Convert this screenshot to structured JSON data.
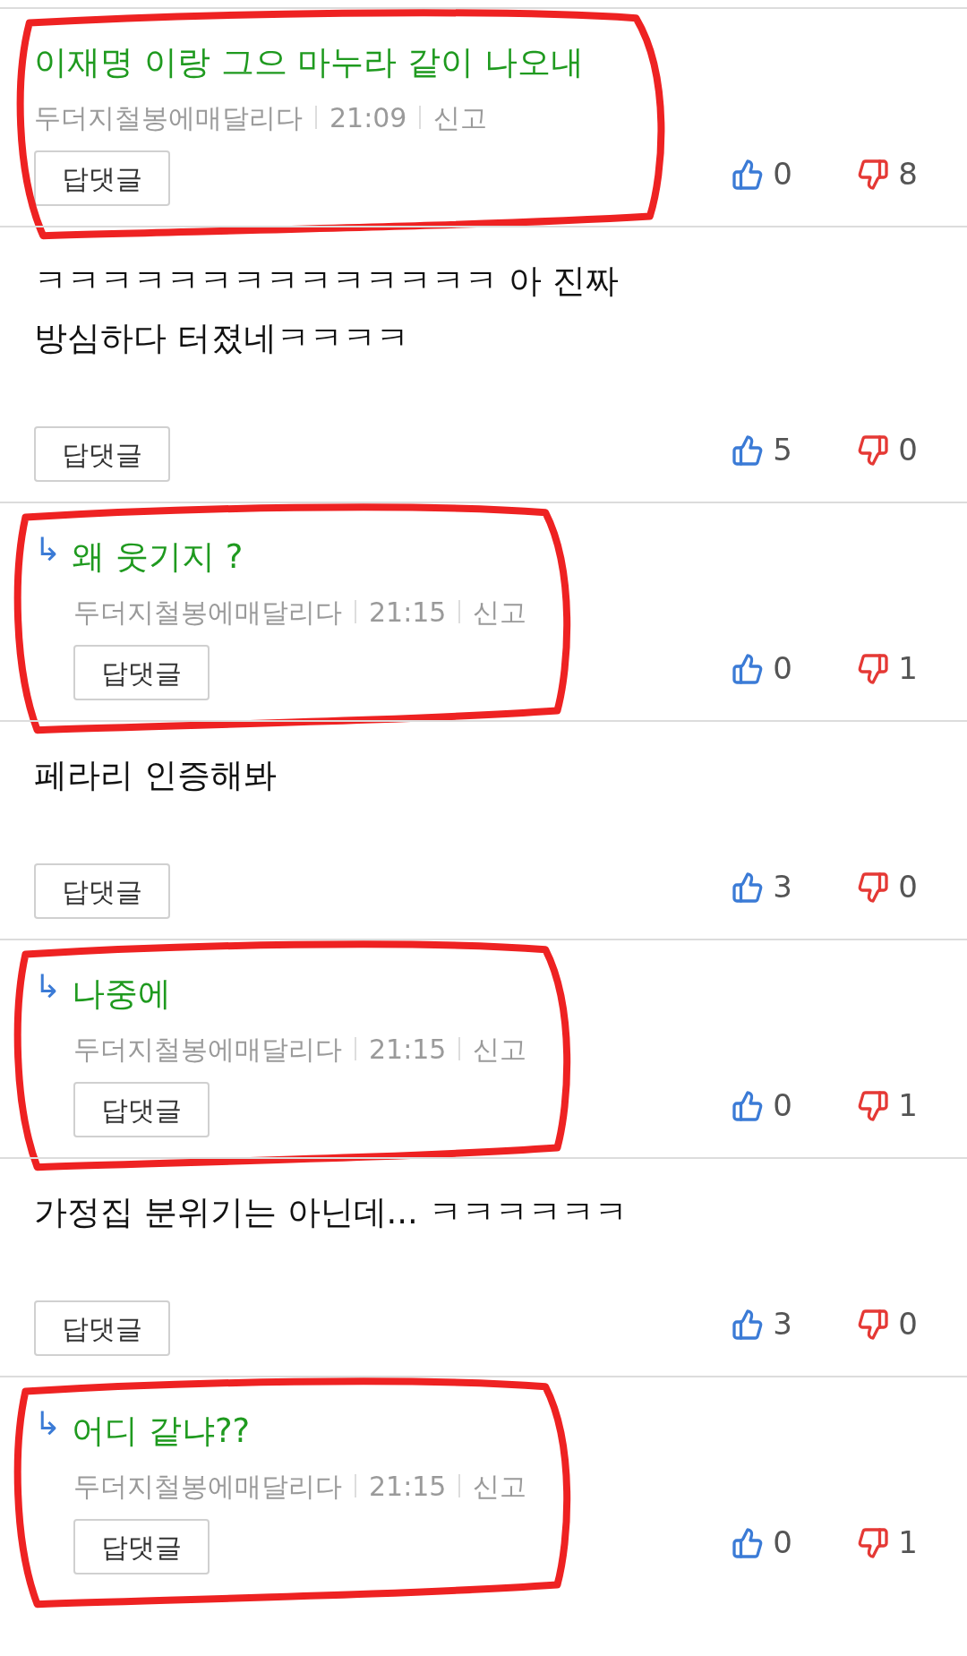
{
  "comments": [
    {
      "kind": "comment",
      "text": "이재명 이랑 그으 마누라 같이 나오내",
      "color": "#1f9a1f",
      "author": "두더지철봉에매달리다",
      "time": "21:09",
      "report": "신고",
      "reply_button": "답댓글",
      "likes": "0",
      "dislikes": "8",
      "circled": true
    },
    {
      "kind": "comment",
      "text": "ㅋㅋㅋㅋㅋㅋㅋㅋㅋㅋㅋㅋㅋㅋ 아 진짜 방심하다 터졌네ㅋㅋㅋㅋ",
      "color": "#111111",
      "reply_button": "답댓글",
      "likes": "5",
      "dislikes": "0",
      "circled": false
    },
    {
      "kind": "reply",
      "arrow": "↳",
      "text": "왜 웃기지 ?",
      "color": "#1f9a1f",
      "author": "두더지철봉에매달리다",
      "time": "21:15",
      "report": "신고",
      "reply_button": "답댓글",
      "likes": "0",
      "dislikes": "1",
      "circled": true
    },
    {
      "kind": "comment",
      "text": "페라리 인증해봐",
      "color": "#111111",
      "reply_button": "답댓글",
      "likes": "3",
      "dislikes": "0",
      "circled": false
    },
    {
      "kind": "reply",
      "arrow": "↳",
      "text": "나중에",
      "color": "#1f9a1f",
      "author": "두더지철봉에매달리다",
      "time": "21:15",
      "report": "신고",
      "reply_button": "답댓글",
      "likes": "0",
      "dislikes": "1",
      "circled": true
    },
    {
      "kind": "comment",
      "text": "가정집 분위기는 아닌데... ㅋㅋㅋㅋㅋㅋ",
      "color": "#111111",
      "reply_button": "답댓글",
      "likes": "3",
      "dislikes": "0",
      "circled": false
    },
    {
      "kind": "reply",
      "arrow": "↳",
      "text": "어디 같냐??",
      "color": "#1f9a1f",
      "author": "두더지철봉에매달리다",
      "time": "21:15",
      "report": "신고",
      "reply_button": "답댓글",
      "likes": "0",
      "dislikes": "1",
      "circled": true
    }
  ]
}
